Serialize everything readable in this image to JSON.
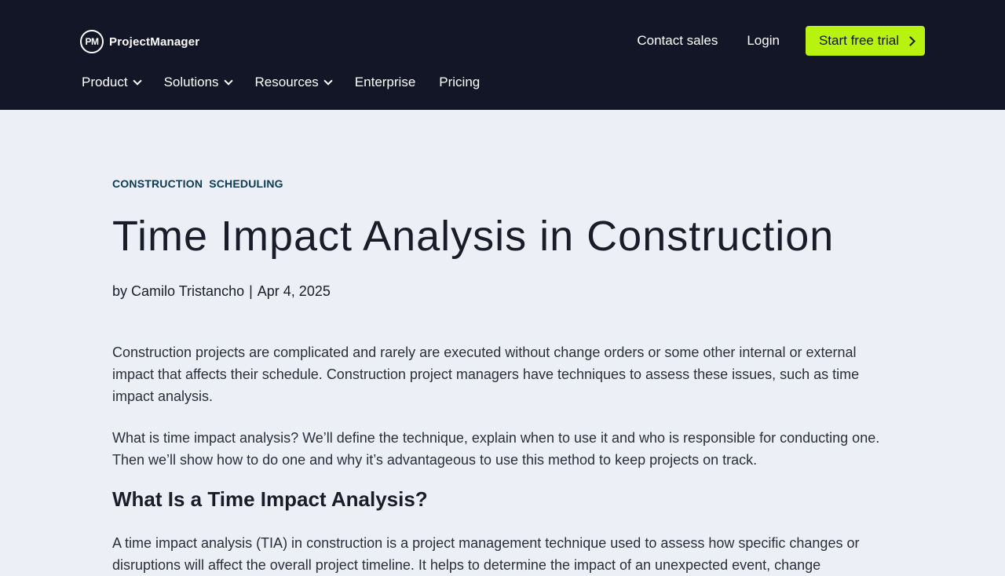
{
  "header": {
    "logo_mark": "PM",
    "logo_text": "ProjectManager",
    "contact_sales": "Contact sales",
    "login": "Login",
    "cta": "Start free trial",
    "nav": [
      {
        "label": "Product",
        "has_dropdown": true
      },
      {
        "label": "Solutions",
        "has_dropdown": true
      },
      {
        "label": "Resources",
        "has_dropdown": true
      },
      {
        "label": "Enterprise",
        "has_dropdown": false
      },
      {
        "label": "Pricing",
        "has_dropdown": false
      }
    ]
  },
  "article": {
    "tags": [
      "CONSTRUCTION",
      "SCHEDULING"
    ],
    "title": "Time Impact Analysis in Construction",
    "byline_prefix": "by",
    "author": "Camilo Tristancho",
    "separator": "|",
    "date": "Apr 4, 2025",
    "paragraphs": [
      "Construction projects are complicated and rarely are executed without change orders or some other internal or external impact that affects their schedule. Construction project managers have techniques to assess these issues, such as time impact analysis.",
      "What is time impact analysis? We’ll define the technique, explain when to use it and who is responsible for conducting one. Then we’ll show how to do one and why it’s advantageous to use this method to keep projects on track."
    ],
    "section_heading": "What Is a Time Impact Analysis?",
    "section_paragraph": "A time impact analysis (TIA) in construction is a project management technique used to assess how specific changes or disruptions will affect the overall project timeline. It helps to determine the impact of an unexpected event, change"
  },
  "colors": {
    "header_bg": "#121626",
    "page_bg": "#ecf0f6",
    "cta_bg": "#b8f20f",
    "tag_color": "#0c3a55"
  }
}
